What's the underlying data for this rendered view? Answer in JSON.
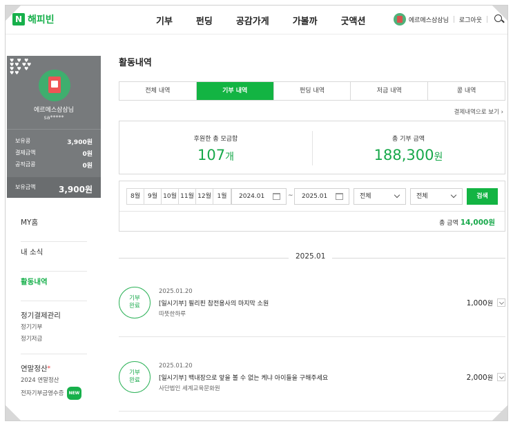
{
  "header": {
    "logo_mark": "N",
    "logo_text": "해피빈",
    "nav": [
      "기부",
      "펀딩",
      "공감가게",
      "가볼까",
      "굿액션"
    ],
    "user_name": "에르메스삼삼님",
    "logout": "로그아웃"
  },
  "profile": {
    "name": "에르메스삼삼님",
    "id_masked": "sa*****",
    "rows": [
      {
        "label": "보유콩",
        "value": "3,900원"
      },
      {
        "label": "결제금액",
        "value": "0원"
      },
      {
        "label": "공적금콩",
        "value": "0원"
      }
    ],
    "total_label": "보유금액",
    "total_value": "3,900원"
  },
  "sidebar": {
    "my_home": "MY홈",
    "my_news": "내 소식",
    "activity": "활동내역",
    "regular_head": "정기결제관리",
    "regular_items": [
      "정기기부",
      "정기저금"
    ],
    "tax_head": "연말정산",
    "tax_required": "*",
    "tax_items": [
      "2024 연말정산",
      "전자기부금영수증"
    ],
    "new_badge": "NEW"
  },
  "main": {
    "title": "활동내역",
    "tabs": [
      "전체 내역",
      "기부 내역",
      "펀딩 내역",
      "저금 내역",
      "콩 내역"
    ],
    "active_tab": 1,
    "detail_link": "결제내역으로 보기 ›",
    "summary": {
      "count_label": "후원한 총 모금함",
      "count_value": "107",
      "count_unit": "개",
      "amount_label": "총 기부 금액",
      "amount_value": "188,300",
      "amount_unit": "원"
    },
    "filter": {
      "months": [
        "8월",
        "9월",
        "10월",
        "11월",
        "12월",
        "1월"
      ],
      "start_date": "2024.01",
      "tilde": "~",
      "end_date": "2025.01",
      "select1": "전체",
      "select2": "전체",
      "search_label": "검색",
      "total_label": "총 금액",
      "total_amount": "14,000원"
    },
    "month_heading": "2025.01",
    "records": [
      {
        "badge": "기부\n완료",
        "date": "2025.01.20",
        "title": "[일시기부] 필리핀 참전용사의 마지막 소원",
        "org": "따뜻한하루",
        "amount": "1,000",
        "unit": "원"
      },
      {
        "badge": "기부\n완료",
        "date": "2025.01.20",
        "title": "[일시기부] 백내장으로 앞을 볼 수 없는 케냐 아이들을 구해주세요",
        "org": "사단법인 세계교육문화원",
        "amount": "2,000",
        "unit": "원"
      }
    ]
  },
  "colors": {
    "brand_green": "#17b04b",
    "profile_gray": "#777a7c"
  }
}
